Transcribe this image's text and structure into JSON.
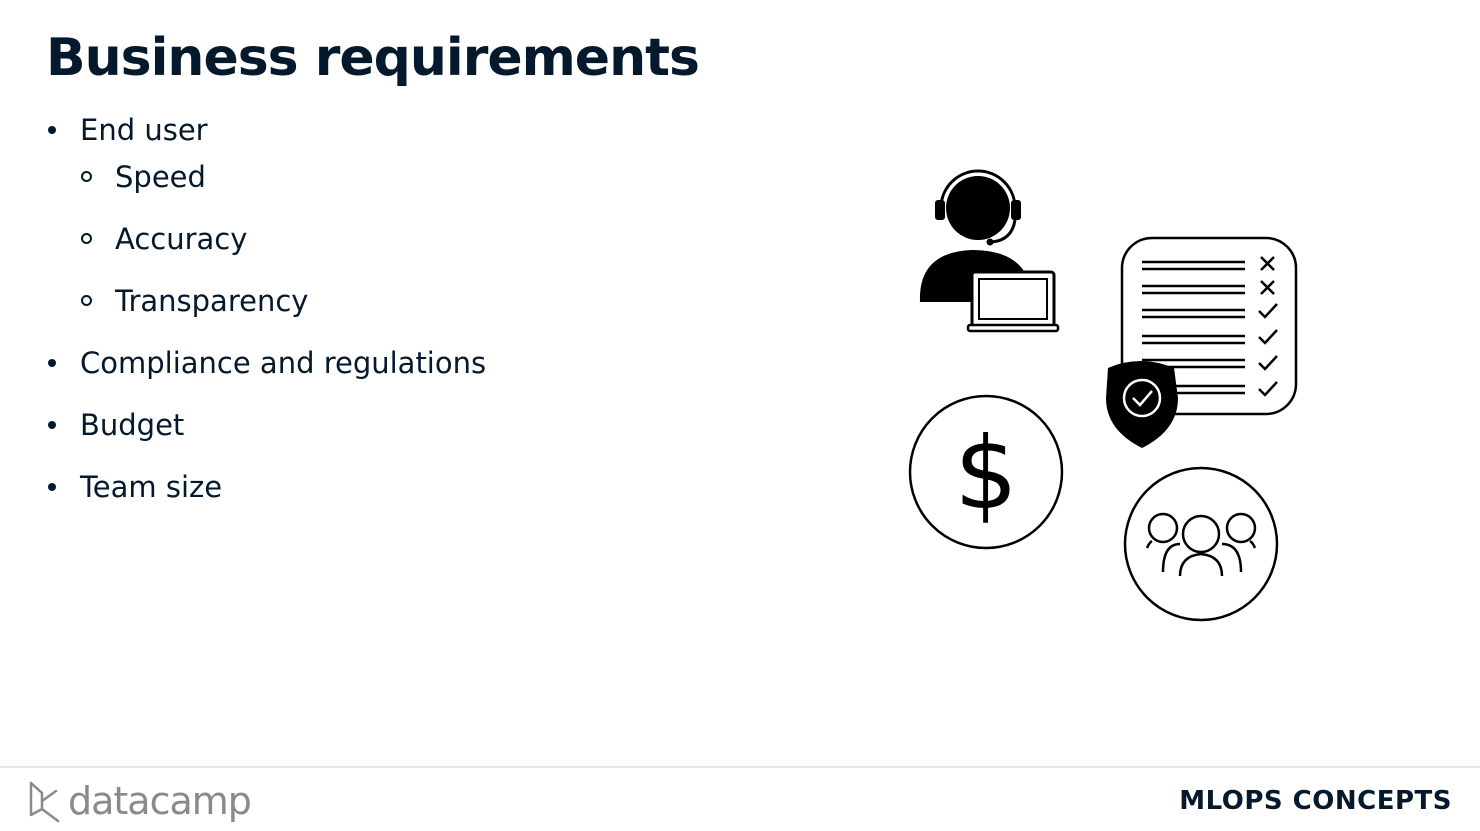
{
  "slide": {
    "title": "Business requirements",
    "bullets": [
      {
        "label": "End user",
        "sub": [
          "Speed",
          "Accuracy",
          "Transparency"
        ]
      },
      {
        "label": "Compliance and regulations"
      },
      {
        "label": "Budget"
      },
      {
        "label": "Team size"
      }
    ]
  },
  "illustration": {
    "icons": [
      "support-agent-icon",
      "checklist-document-icon",
      "shield-check-icon",
      "dollar-coin-icon",
      "team-group-icon"
    ],
    "dollar_symbol": "$",
    "color": "#000000"
  },
  "footer": {
    "logo_text": "datacamp",
    "course_name": "MLOPS CONCEPTS"
  }
}
